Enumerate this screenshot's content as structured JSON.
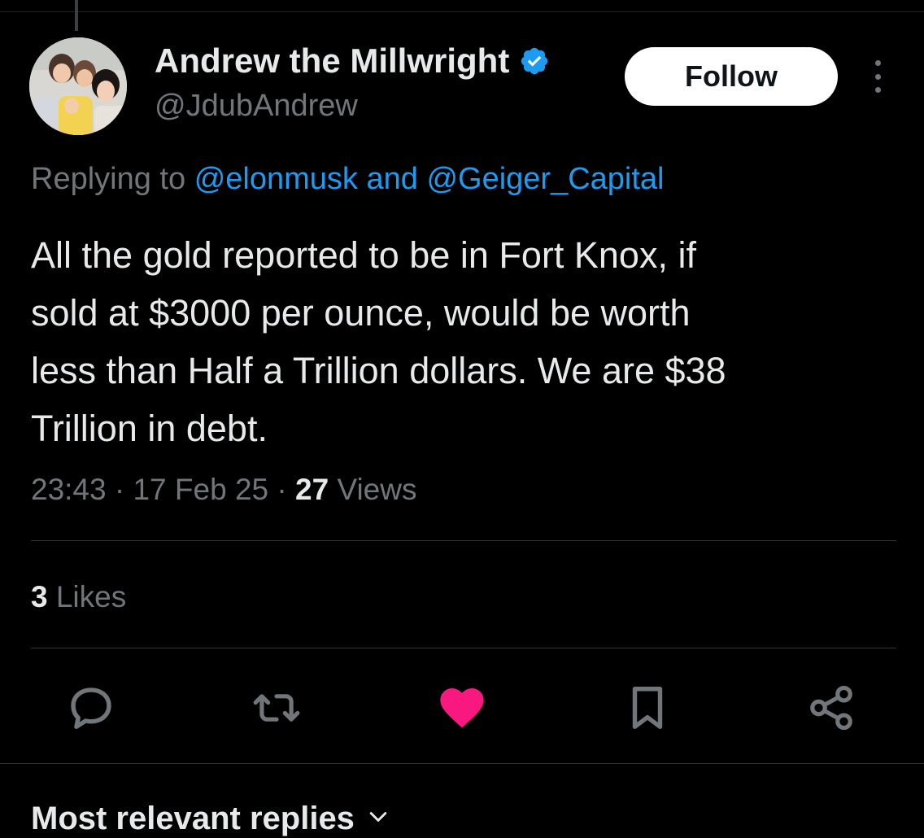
{
  "author": {
    "name": "Andrew the Millwright",
    "handle": "@JdubAndrew",
    "verified": true
  },
  "follow_button": {
    "label": "Follow"
  },
  "reply_context": {
    "prefix": "Replying to",
    "mention_1": "@elonmusk",
    "conjunction": "and",
    "mention_2": "@Geiger_Capital"
  },
  "tweet": {
    "text": "All the gold reported to be in Fort Knox, if\nsold at $3000 per ounce, would be worth\nless than Half a Trillion dollars. We are $38\nTrillion in debt.",
    "time": "23:43",
    "separator": "·",
    "date": "17 Feb 25",
    "views_count": "27",
    "views_label": "Views"
  },
  "engagement": {
    "likes_count": "3",
    "likes_label": "Likes"
  },
  "actions": [
    {
      "name": "reply",
      "icon": "reply-icon"
    },
    {
      "name": "repost",
      "icon": "repost-icon"
    },
    {
      "name": "like",
      "icon": "heart-icon",
      "active": true
    },
    {
      "name": "bookmark",
      "icon": "bookmark-icon"
    },
    {
      "name": "share",
      "icon": "share-icon"
    }
  ],
  "replies_section": {
    "title": "Most relevant replies"
  },
  "colors": {
    "background": "#000000",
    "text": "#e7e9ea",
    "muted": "#71767b",
    "link": "#1d9bf0",
    "like_active": "#f91880",
    "verified": "#1d9bf0"
  }
}
